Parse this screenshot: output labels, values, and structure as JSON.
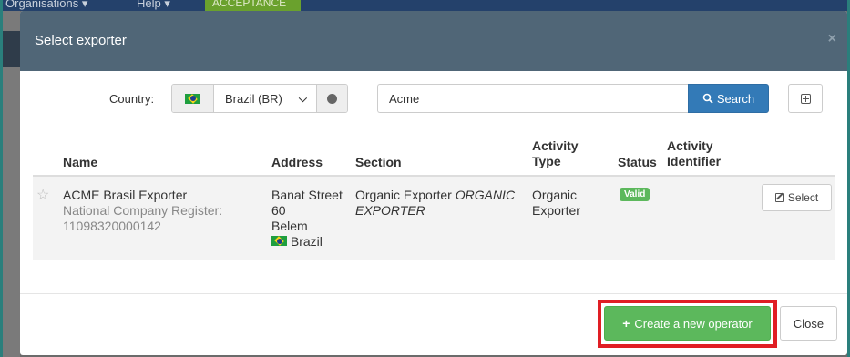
{
  "background": {
    "menu_organisations": "Organisations ▾",
    "menu_help": "Help ▾",
    "acceptance": "ACCEPTANCE"
  },
  "modal": {
    "title": "Select exporter",
    "close_symbol": "×"
  },
  "search": {
    "country_label": "Country:",
    "country_value": "Brazil (BR)",
    "query_value": "Acme",
    "search_button": "Search"
  },
  "table": {
    "headers": {
      "name": "Name",
      "address": "Address",
      "section": "Section",
      "activity_type_line1": "Activity",
      "activity_type_line2": "Type",
      "status": "Status",
      "activity_identifier_line1": "Activity",
      "activity_identifier_line2": "Identifier"
    },
    "rows": [
      {
        "name": "ACME Brasil Exporter",
        "register_label": "National Company Register:",
        "register_number": "11098320000142",
        "address_line1": "Banat Street",
        "address_line2": "60",
        "address_line3": "Belem",
        "address_country": "Brazil",
        "section_line1_plain": "Organic Exporter ",
        "section_line1_italic": "ORGANIC",
        "section_line2_italic": "EXPORTER",
        "activity_type_line1": "Organic",
        "activity_type_line2": "Exporter",
        "status": "Valid",
        "select_button": "Select"
      }
    ]
  },
  "footer": {
    "create_button": "Create a new operator",
    "close_button": "Close"
  },
  "colors": {
    "header_bg": "#506677",
    "primary": "#337ab7",
    "success": "#5cb85c",
    "highlight": "#e01e24"
  }
}
